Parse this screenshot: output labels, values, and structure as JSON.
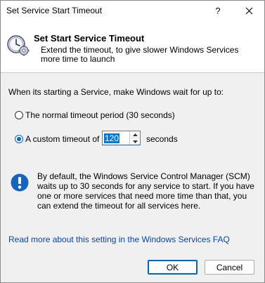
{
  "window": {
    "title": "Set Service Start Timeout",
    "help_glyph": "?",
    "close_glyph": "✕"
  },
  "header": {
    "icon": "clock-gear-icon",
    "title": "Set Start Service Timeout",
    "description": "Extend the timeout, to give slower Windows Services more time to launch"
  },
  "form": {
    "prompt": "When its starting a Service, make Windows wait for up to:",
    "option_normal": "The normal timeout period (30 seconds)",
    "option_custom": "A custom timeout of",
    "selected_option": "custom",
    "timeout_value": "120",
    "unit": "seconds"
  },
  "info": {
    "icon": "info-icon",
    "text": "By default, the Windows Service Control Manager (SCM) waits up to 30 seconds for any service to start. If you have one or more services that need more time than that, you can extend the timeout for all services here."
  },
  "link": {
    "text": "Read more about this setting in the Windows Services FAQ"
  },
  "buttons": {
    "ok": "OK",
    "cancel": "Cancel"
  },
  "colors": {
    "accent": "#0067c0",
    "link": "#0645ad",
    "info_blue": "#1565c0"
  }
}
